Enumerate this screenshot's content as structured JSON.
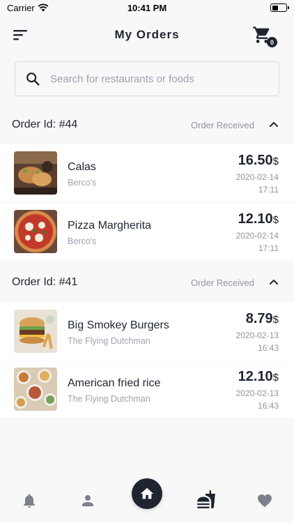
{
  "status_bar": {
    "carrier": "Carrier",
    "time": "10:41 PM"
  },
  "header": {
    "title": "My Orders",
    "cart_count": "0"
  },
  "search": {
    "placeholder": "Search for restaurants or foods"
  },
  "orders": [
    {
      "id_label": "Order Id: #44",
      "status": "Order Received",
      "items": [
        {
          "name": "Calas",
          "restaurant": "Berco's",
          "price": "16.50",
          "currency": "$",
          "date": "2020-02-14",
          "time": "17:11"
        },
        {
          "name": "Pizza Margherita",
          "restaurant": "Berco's",
          "price": "12.10",
          "currency": "$",
          "date": "2020-02-14",
          "time": "17:11"
        }
      ]
    },
    {
      "id_label": "Order Id: #41",
      "status": "Order Received",
      "items": [
        {
          "name": "Big Smokey Burgers",
          "restaurant": "The Flying Dutchman",
          "price": "8.79",
          "currency": "$",
          "date": "2020-02-13",
          "time": "16:43"
        },
        {
          "name": "American fried rice",
          "restaurant": "The Flying Dutchman",
          "price": "12.10",
          "currency": "$",
          "date": "2020-02-13",
          "time": "16:43"
        }
      ]
    }
  ],
  "bottom_nav": {
    "items": [
      {
        "icon": "bell-icon"
      },
      {
        "icon": "person-icon"
      },
      {
        "icon": "home-icon"
      },
      {
        "icon": "fastfood-icon"
      },
      {
        "icon": "heart-icon"
      }
    ]
  },
  "colors": {
    "primary": "#1f2430",
    "muted": "#8f949e",
    "background": "#f8f8f9"
  }
}
